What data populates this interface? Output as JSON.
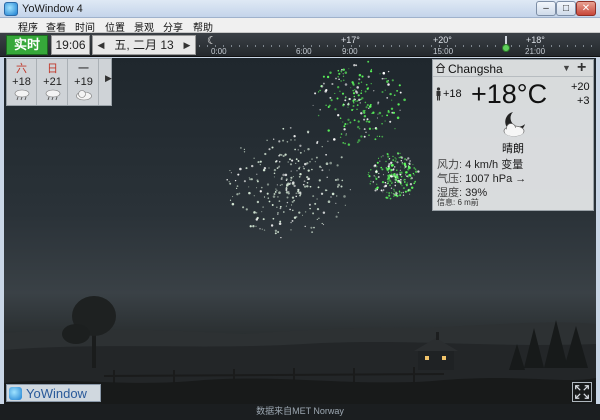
{
  "window": {
    "title": "YoWindow 4",
    "minimize": "–",
    "maximize": "□",
    "close": "✕"
  },
  "menu": [
    "程序",
    "查看",
    "时间",
    "位置",
    "景观",
    "分享",
    "帮助"
  ],
  "timebar": {
    "live_label": "实时",
    "clock": "19:06",
    "date": "五, 二月 13",
    "prev": "◀",
    "next": "▶",
    "temps": [
      "+17°",
      "+20°",
      "+18°"
    ],
    "hours": [
      "0:00",
      "6:00",
      "9:00",
      "15:00",
      "21:00"
    ]
  },
  "forecast": {
    "days": [
      {
        "name": "六",
        "temp": "+18",
        "icon": "rain-cloud-icon",
        "color": "#c0392b"
      },
      {
        "name": "日",
        "temp": "+21",
        "icon": "rain-cloud-icon",
        "color": "#c0392b"
      },
      {
        "name": "一",
        "temp": "+19",
        "icon": "cloud-icon",
        "color": "#222222"
      }
    ],
    "more": "▶"
  },
  "weather": {
    "city": "Changsha",
    "dropdown": "▼",
    "add": "+",
    "feels_like": "+18",
    "temperature": "+18°C",
    "high": "+20",
    "low": "+3",
    "condition_icon": "moon-cloud-icon",
    "condition": "晴朗",
    "wind_label": "风力:",
    "wind_value": "4 km/h 变量",
    "pressure_label": "气压:",
    "pressure_value": "1007 hPa →",
    "humidity_label": "湿度:",
    "humidity_value": "39%",
    "note": "信息: 6 m前"
  },
  "footer": {
    "logo_text": "YoWindow",
    "credit": "数据来自MET Norway"
  },
  "colors": {
    "live_green": "#36a83a",
    "firework_green": "#5dff5d",
    "logo_blue": "#2a5a9a"
  }
}
